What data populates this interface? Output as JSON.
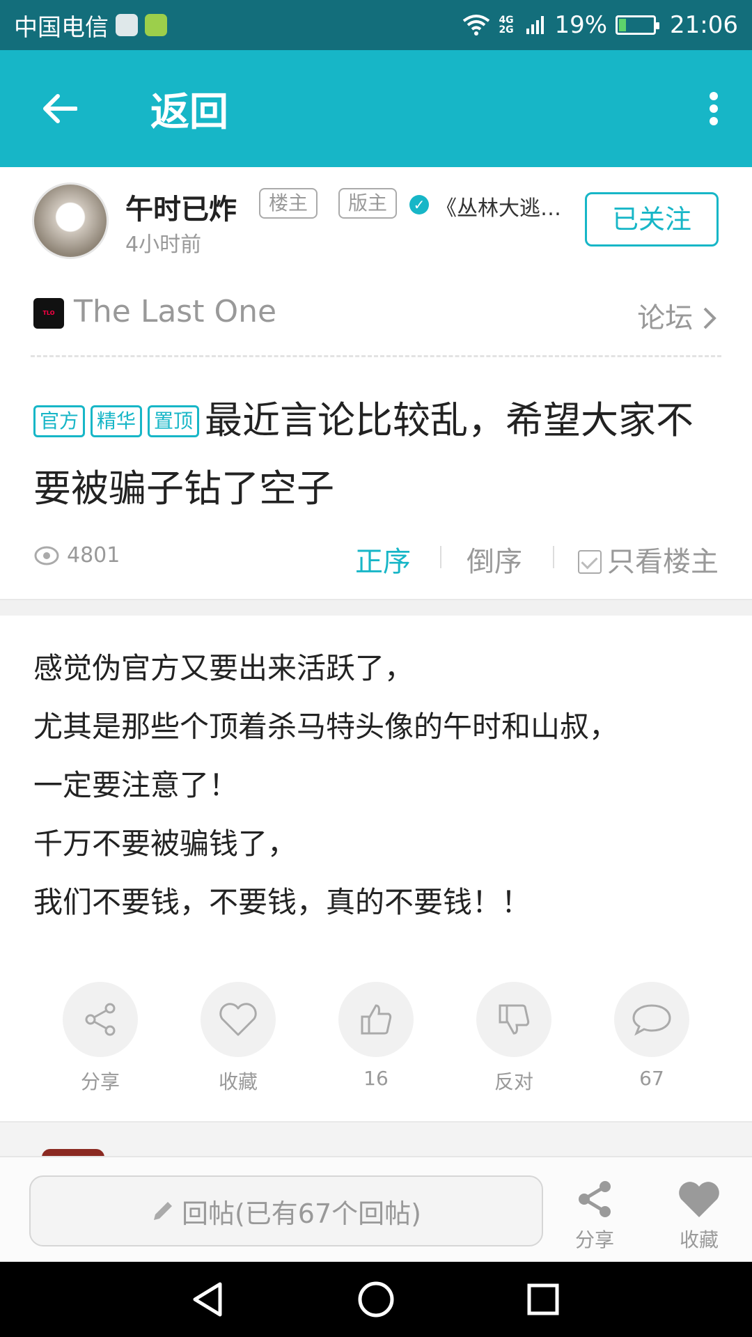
{
  "status_bar": {
    "carrier": "中国电信",
    "network": "4G 2G",
    "battery": "19%",
    "time": "21:06"
  },
  "app_bar": {
    "back_icon": "arrow-left-icon",
    "title": "返回",
    "more_icon": "more-vertical-icon"
  },
  "author": {
    "name": "午时已炸",
    "badges": [
      "楼主",
      "版主"
    ],
    "verified_note": "《丛林大逃杀…",
    "time_ago": "4小时前",
    "follow_label": "已关注"
  },
  "forum": {
    "name": "The Last One",
    "link_label": "论坛"
  },
  "post": {
    "tags": [
      "官方",
      "精华",
      "置顶"
    ],
    "title": "最近言论比较乱，希望大家不要被骗子钻了空子",
    "views": "4801",
    "sort_asc": "正序",
    "sort_desc": "倒序",
    "only_op": "只看楼主",
    "body": [
      "感觉伪官方又要出来活跃了，",
      "尤其是那些个顶着杀马特头像的午时和山叔，",
      "一定要注意了！",
      "千万不要被骗钱了，",
      "我们不要钱，不要钱，真的不要钱！！"
    ]
  },
  "actions": [
    {
      "icon": "share-icon",
      "label": "分享"
    },
    {
      "icon": "heart-icon",
      "label": "收藏"
    },
    {
      "icon": "thumbs-up-icon",
      "label": "16"
    },
    {
      "icon": "thumbs-down-icon",
      "label": "反对"
    },
    {
      "icon": "comment-icon",
      "label": "67"
    }
  ],
  "reply_bar": {
    "placeholder": "回帖(已有67个回帖)",
    "share_label": "分享",
    "collect_label": "收藏"
  },
  "colors": {
    "status_bar": "#136e7b",
    "accent": "#17b6c7"
  }
}
